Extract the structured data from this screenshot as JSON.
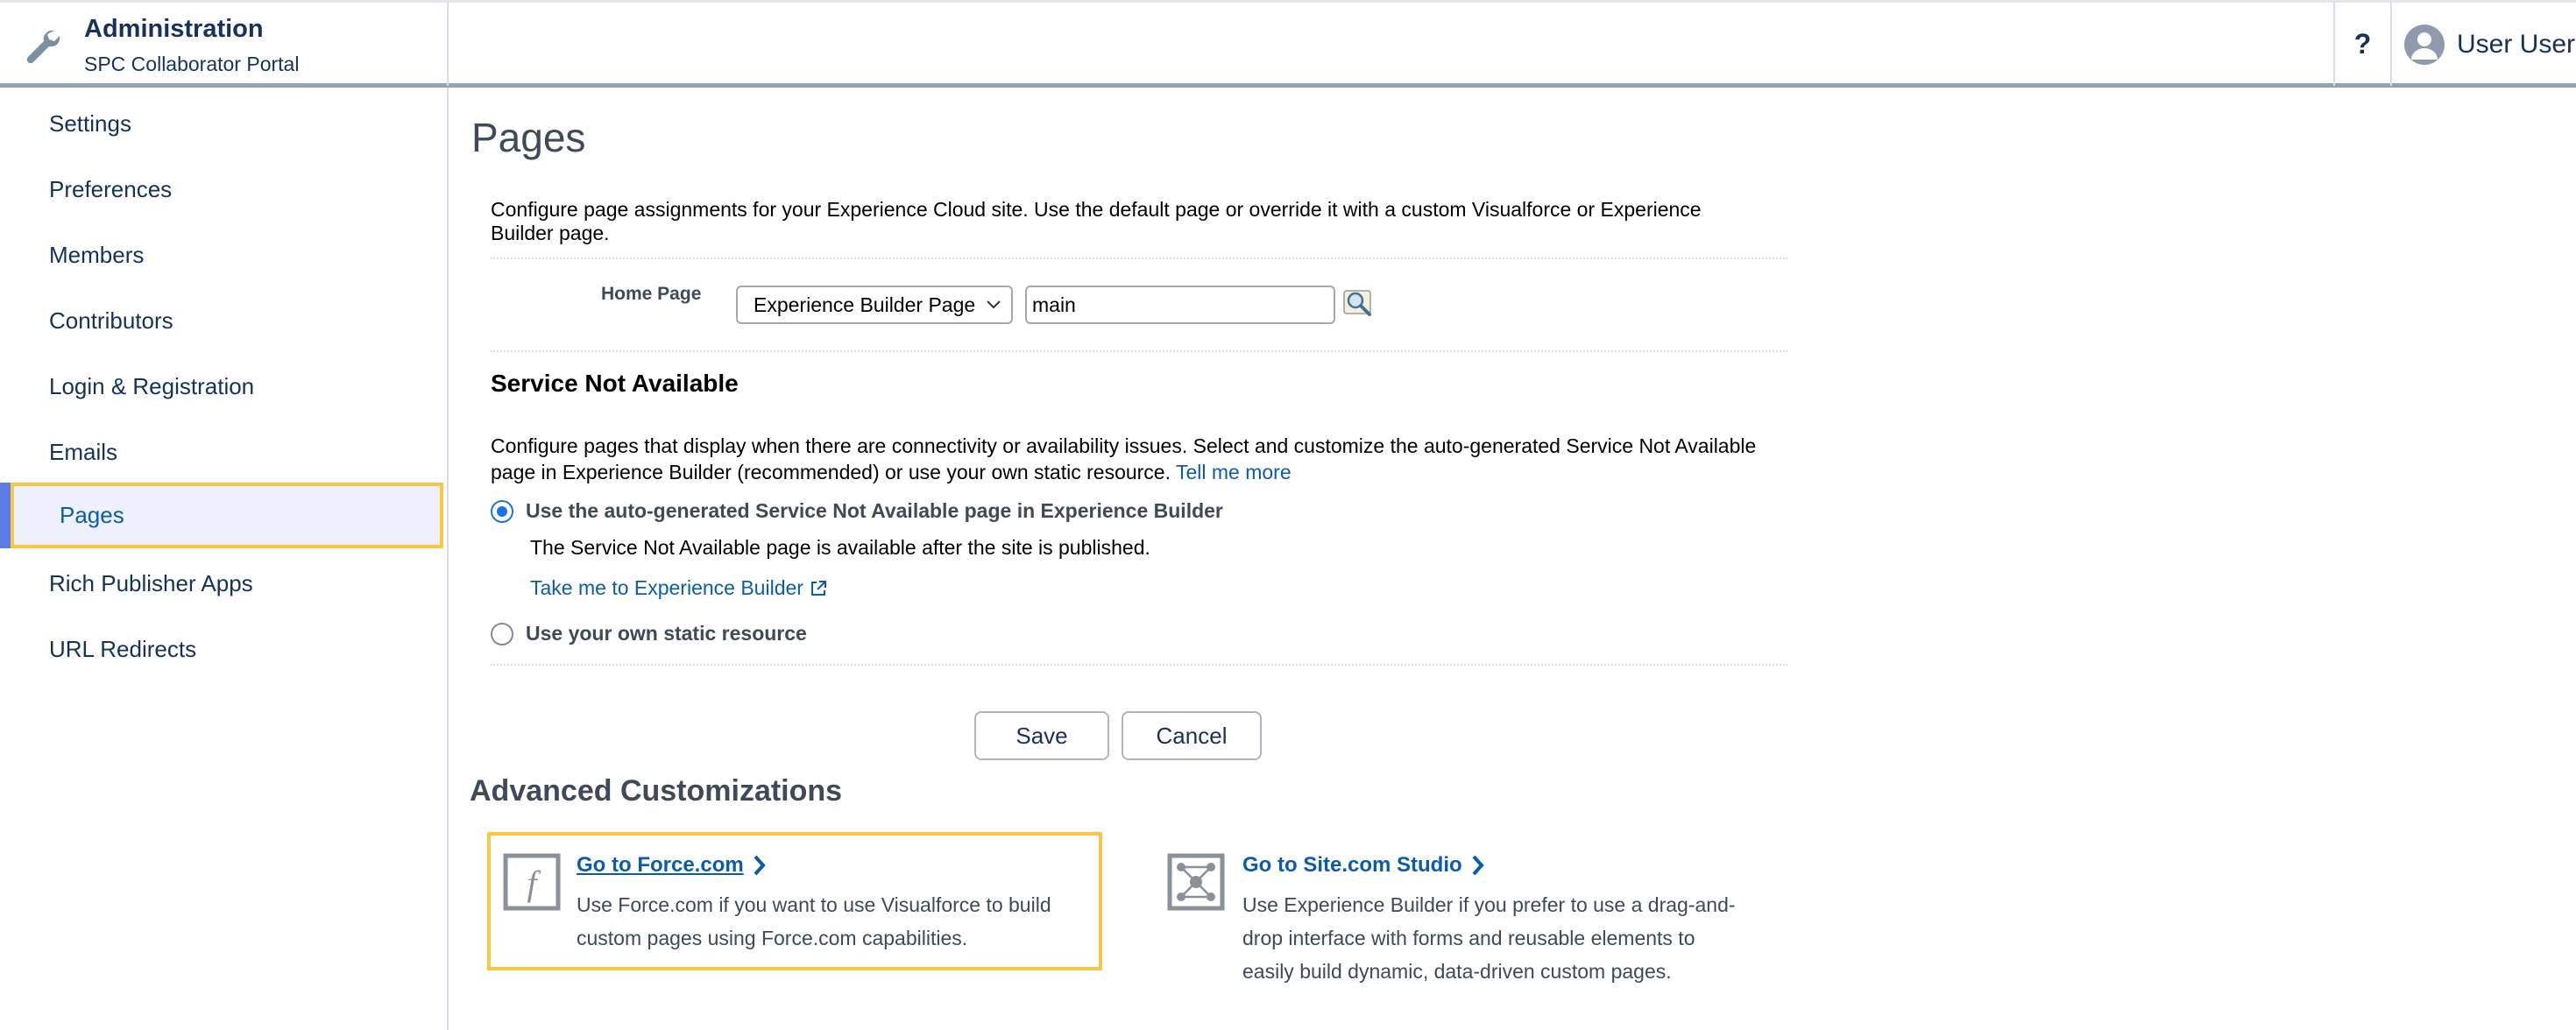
{
  "header": {
    "title": "Administration",
    "subtitle": "SPC Collaborator Portal",
    "help_label": "?",
    "user_name": "User User"
  },
  "sidebar": {
    "items": [
      {
        "label": "Settings"
      },
      {
        "label": "Preferences"
      },
      {
        "label": "Members"
      },
      {
        "label": "Contributors"
      },
      {
        "label": "Login & Registration"
      },
      {
        "label": "Emails"
      },
      {
        "label": "Pages",
        "active": true
      },
      {
        "label": "Rich Publisher Apps"
      },
      {
        "label": "URL Redirects"
      }
    ]
  },
  "main": {
    "title": "Pages",
    "intro": "Configure page assignments for your Experience Cloud site. Use the default page or override it with a custom Visualforce or Experience Builder page.",
    "home_page": {
      "label": "Home Page",
      "type_selected": "Experience Builder Page",
      "value": "main"
    },
    "service_not_available": {
      "heading": "Service Not Available",
      "description": "Configure pages that display when there are connectivity or availability issues. Select and customize the auto-generated Service  Not Available page in Experience Builder (recommended) or use your own static resource.",
      "tell_me_more": "Tell me more",
      "option_auto": "Use the auto-generated Service Not Available page in Experience Builder",
      "option_auto_note": "The Service Not Available page is available after the site is published.",
      "builder_link": "Take me to Experience Builder",
      "option_static": "Use your own static resource"
    },
    "buttons": {
      "save": "Save",
      "cancel": "Cancel"
    },
    "advanced": {
      "heading": "Advanced Customizations",
      "force": {
        "link": "Go to Force.com",
        "desc_line1": "Use Force.com if you want to use Visualforce to build",
        "desc_line2": "custom pages using Force.com capabilities."
      },
      "site": {
        "link": "Go to Site.com Studio",
        "desc_line1": "Use Experience Builder if you prefer to use a drag-and-",
        "desc_line2": "drop interface with forms and reusable elements to",
        "desc_line3": "easily build dynamic, data-driven custom pages."
      }
    }
  },
  "colors": {
    "brand_text": "#16325c",
    "link": "#0b5cab",
    "highlight": "#f8c744",
    "active_bar": "#5b7ce6",
    "radio": "#1b74e4"
  },
  "icons": {
    "header": "wrench-icon",
    "lookup": "lookup-icon",
    "force": "force-f-icon",
    "site": "site-studio-icon"
  }
}
